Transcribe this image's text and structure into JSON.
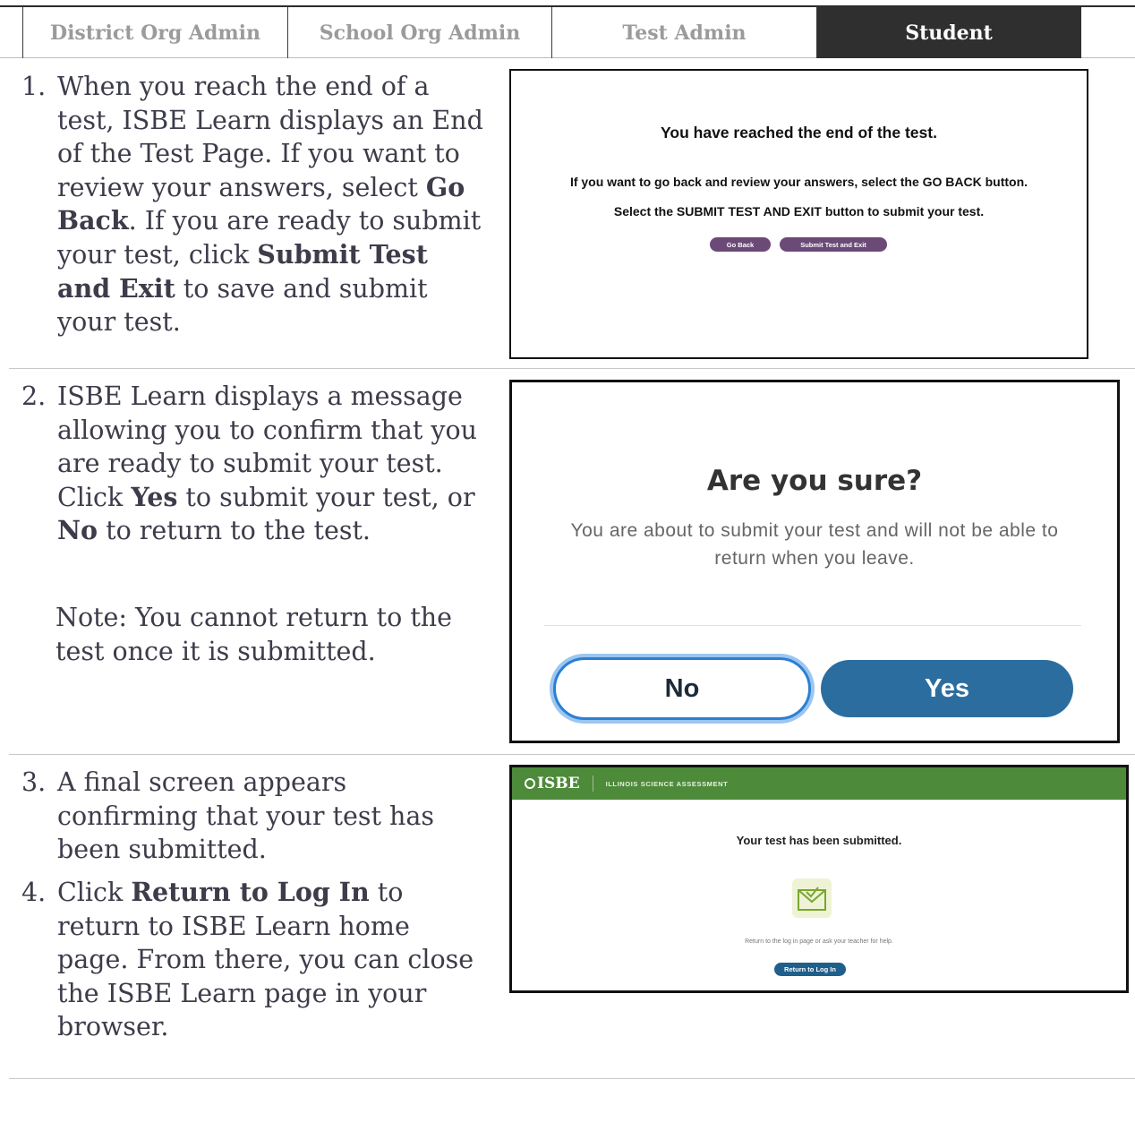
{
  "tabs": [
    {
      "label": "District Org Admin",
      "active": false
    },
    {
      "label": "School Org Admin",
      "active": false
    },
    {
      "label": "Test Admin",
      "active": false
    },
    {
      "label": "Student",
      "active": true
    }
  ],
  "steps": [
    {
      "number": "1.",
      "parts": [
        "When you reach the end of a test, ISBE Learn displays an End of the Test Page.  If you want to review your answers, select ",
        "Go Back",
        ".  If you are ready to submit your test, click ",
        "Submit Test and Exit",
        " to save and submit your test."
      ]
    },
    {
      "number": "2.",
      "parts": [
        "ISBE Learn displays a message allowing you to confirm that you are ready to submit your test. Click ",
        "Yes",
        " to submit your test, or ",
        "No",
        " to return to the test."
      ],
      "note": "Note: You cannot return to the test once it is submitted."
    },
    {
      "number": "3.",
      "text": "A final screen appears confirming that your test has been submitted."
    },
    {
      "number": "4.",
      "parts": [
        "Click ",
        "Return to Log In",
        " to return to ISBE Learn home page. From there, you can close the ISBE Learn page in your browser."
      ]
    }
  ],
  "end_of_test_screen": {
    "heading": "You have reached the end of the test.",
    "line1": "If you want to go back and review your answers, select the GO BACK button.",
    "line2": "Select the SUBMIT TEST AND EXIT button to submit your test.",
    "go_back_button": "Go Back",
    "submit_button": "Submit Test and Exit",
    "button_color": "#6b4a78"
  },
  "confirm_dialog": {
    "title": "Are you sure?",
    "message": "You are about to submit your test and will not be able to return when you leave.",
    "no_button": "No",
    "yes_button": "Yes",
    "yes_color": "#2c6da0",
    "no_focus_color": "#2b7fd4"
  },
  "submitted_screen": {
    "logo": "ISBE",
    "org_name": "ILLINOIS SCIENCE ASSESSMENT",
    "message": "Your test has been submitted.",
    "icon": "envelope-check-icon",
    "help_text": "Return to the log in page or ask your teacher for help.",
    "return_button": "Return to Log In",
    "header_color": "#4d8a3a"
  }
}
